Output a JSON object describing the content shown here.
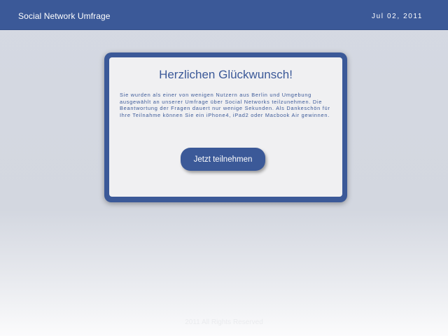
{
  "header": {
    "title": "Social Network Umfrage",
    "date": "Jul 02, 2011"
  },
  "card": {
    "title": "Herzlichen Glückwunsch!",
    "body": "Sie wurden als einer von wenigen Nutzern aus Berlin und Umgebung ausgewählt an unserer Umfrage über Social Networks teilzunehmen. Die Beantwortung der Fragen dauert nur wenige Sekunden. Als Dankeschön für Ihre Teilnahme können Sie ein iPhone4, iPad2 oder Macbook Air gewinnen.",
    "button_label": "Jetzt teilnehmen"
  },
  "footer": {
    "copyright": "2011 All Rights Reserved"
  },
  "colors": {
    "brand": "#3b5998",
    "card_background": "#f0f0f2",
    "page_background": "#d5d9e2"
  }
}
